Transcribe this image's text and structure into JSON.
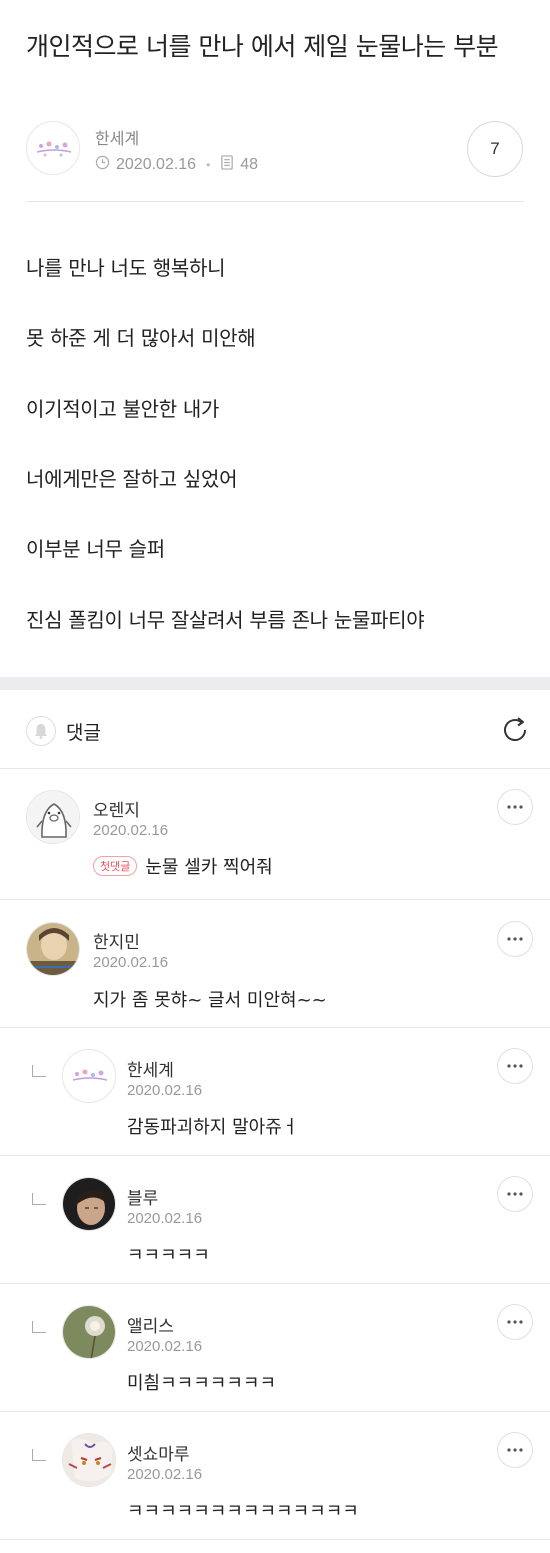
{
  "post": {
    "title": "개인적으로 너를 만나 에서 제일 눈물나는 부분",
    "author": "한세계",
    "date": "2020.02.16",
    "views": "48",
    "comment_count": "7"
  },
  "body_lines": [
    "나를 만나 너도 행복하니",
    "못 하준 게 더 많아서 미안해",
    "이기적이고 불안한 내가",
    "너에게만은 잘하고 싶었어",
    "이부분 너무 슬퍼",
    "진심 폴킴이 너무 잘살려서 부름 존나 눈물파티야"
  ],
  "comments_section": {
    "label": "댓글"
  },
  "comments": [
    {
      "name": "오렌지",
      "date": "2020.02.16",
      "badge": "첫댓글",
      "text": "눈물 셀카 찍어줘",
      "reply": false
    },
    {
      "name": "한지민",
      "date": "2020.02.16",
      "text": "지가 좀 못햐~ 글서 미안혀~~",
      "reply": false
    },
    {
      "name": "한세계",
      "date": "2020.02.16",
      "text": "감동파괴하지 말아쥬ㅓ",
      "reply": true
    },
    {
      "name": "블루",
      "date": "2020.02.16",
      "text": "ㅋㅋㅋㅋㅋ",
      "reply": true
    },
    {
      "name": "앨리스",
      "date": "2020.02.16",
      "text": "미칌ㅋㅋㅋㅋㅋㅋㅋ",
      "reply": true
    },
    {
      "name": "셋쇼마루",
      "date": "2020.02.16",
      "text": "ㅋㅋㅋㅋㅋㅋㅋㅋㅋㅋㅋㅋㅋㅋ",
      "reply": true
    }
  ],
  "icons": {
    "clock": "clock-icon",
    "document": "document-icon",
    "bell": "bell-icon",
    "refresh": "refresh-icon",
    "more": "more-icon"
  },
  "colors": {
    "badge": "#e8505b",
    "divider": "#e6e6e6",
    "band": "#ececef"
  }
}
